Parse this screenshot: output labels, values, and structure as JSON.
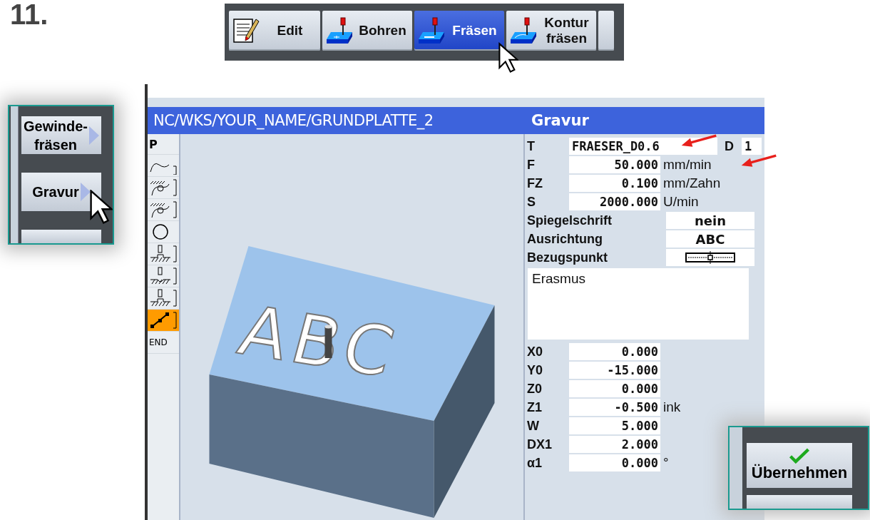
{
  "step_number": "11.",
  "softkey_bar": [
    {
      "label": "Edit",
      "kind": "edit",
      "selected": false
    },
    {
      "label": "Bohren",
      "kind": "drill",
      "selected": false
    },
    {
      "label": "Fräsen",
      "kind": "mill",
      "selected": true
    },
    {
      "label": "Kontur\nfräsen",
      "kind": "contour",
      "selected": false
    }
  ],
  "side_menu": [
    {
      "label": "Gewinde-\nfräsen"
    },
    {
      "label": "Gravur"
    }
  ],
  "main_window": {
    "path_title": "NC/WKS/YOUR_NAME/GRUNDPLATTE_2",
    "form_title": "Gravur",
    "cycle_list": [
      {
        "kind": "text",
        "label": "P",
        "selected": false
      },
      {
        "kind": "contour",
        "selected": false
      },
      {
        "kind": "pocket",
        "selected": false
      },
      {
        "kind": "pocket",
        "selected": false
      },
      {
        "kind": "circle",
        "selected": false
      },
      {
        "kind": "groove",
        "selected": false
      },
      {
        "kind": "groove-round",
        "selected": false
      },
      {
        "kind": "slot",
        "selected": false
      },
      {
        "kind": "engrave",
        "selected": true
      },
      {
        "kind": "text",
        "label": "END",
        "selected": false
      }
    ],
    "preview_text": "ABC",
    "tool": {
      "label": "T",
      "value": "FRAESER_D0.6",
      "d_label": "D",
      "d_value": "1"
    },
    "tech_params": [
      {
        "label": "F",
        "value": "50.000",
        "unit": "mm/min"
      },
      {
        "label": "FZ",
        "value": "0.100",
        "unit": "mm/Zahn"
      },
      {
        "label": "S",
        "value": "2000.000",
        "unit": "U/min"
      }
    ],
    "options": [
      {
        "label": "Spiegelschrift",
        "kind": "text",
        "value": "nein"
      },
      {
        "label": "Ausrichtung",
        "kind": "text",
        "value": "ABC"
      },
      {
        "label": "Bezugspunkt",
        "kind": "reference-icon"
      }
    ],
    "engraving_text": "Erasmus",
    "geometry_params": [
      {
        "label": "X0",
        "value": "0.000"
      },
      {
        "label": "Y0",
        "value": "-15.000"
      },
      {
        "label": "Z0",
        "value": "0.000"
      },
      {
        "label": "Z1",
        "value": "-0.500",
        "unit": "ink"
      },
      {
        "label": "W",
        "value": "5.000"
      },
      {
        "label": "DX1",
        "value": "2.000"
      },
      {
        "label": "α1",
        "value": "0.000",
        "unit": "°"
      }
    ]
  },
  "accept_button": {
    "label": "Übernehmen"
  }
}
